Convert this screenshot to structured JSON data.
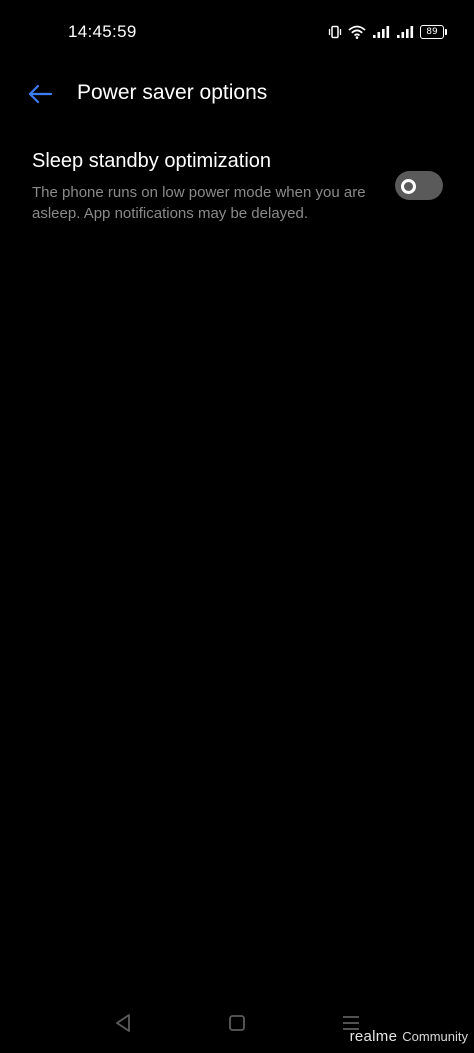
{
  "status_bar": {
    "time": "14:45:59",
    "battery_level": "89",
    "icons": [
      "vibrate-icon",
      "wifi-icon",
      "signal-icon",
      "signal-icon",
      "battery-icon"
    ]
  },
  "header": {
    "title": "Power saver options",
    "back_icon": "arrow-left-icon"
  },
  "setting": {
    "title": "Sleep standby optimization",
    "description": "The phone runs on low power mode when you are asleep. App notifications may be delayed.",
    "toggle_on": false
  },
  "nav_bar": {
    "icons": [
      "triangle-back-icon",
      "square-home-icon",
      "menu-lines-icon"
    ]
  },
  "watermark": {
    "brand": "realme",
    "label": "Community"
  },
  "colors": {
    "background": "#000000",
    "accent": "#3d7cf5",
    "secondary_text": "#8a8a8a",
    "toggle_off": "#5a5a5a"
  }
}
